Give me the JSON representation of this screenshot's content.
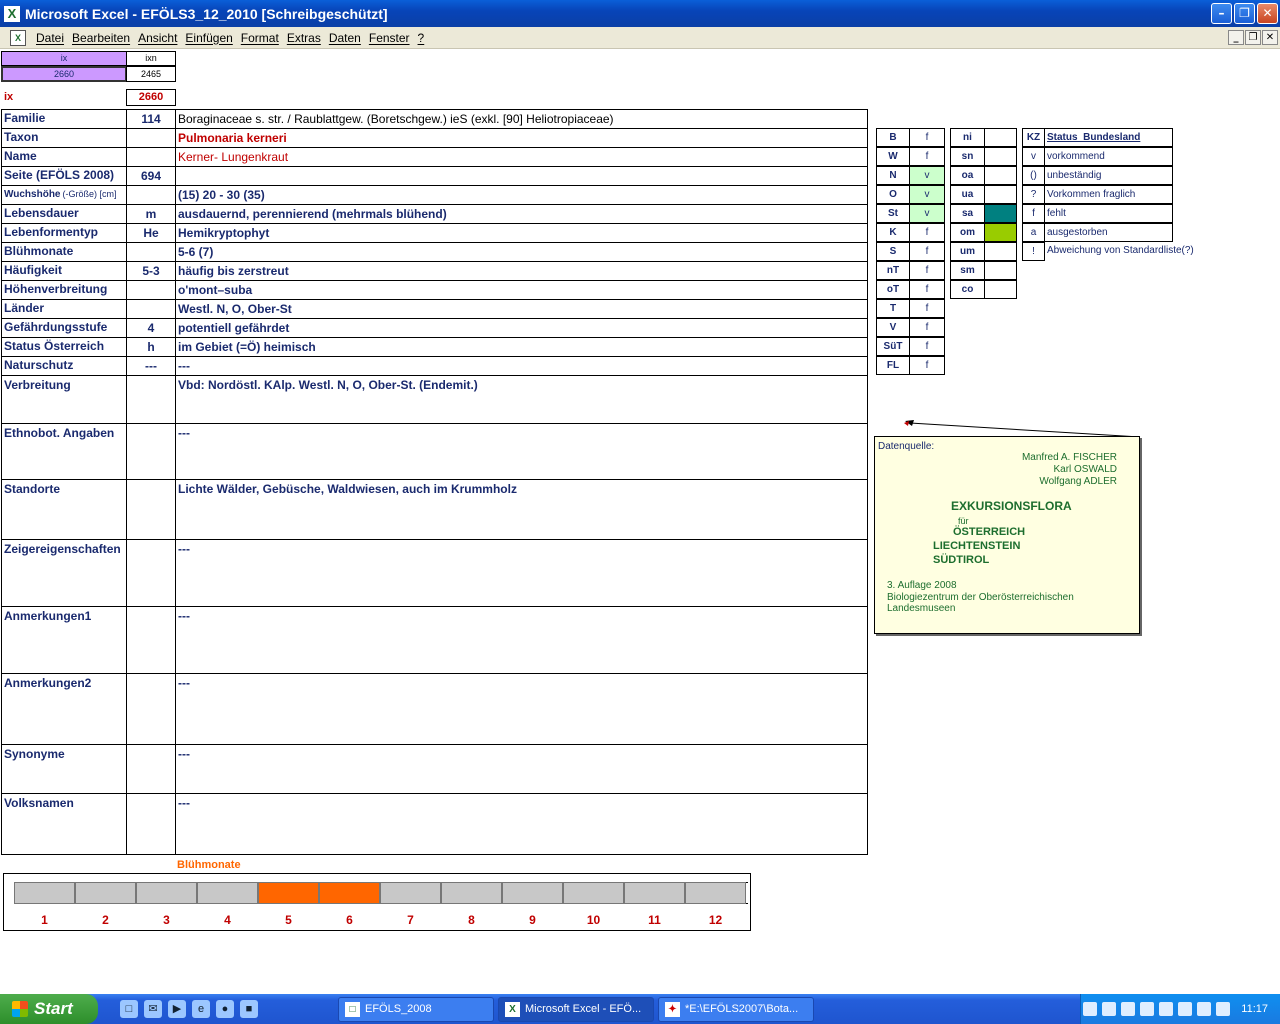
{
  "window": {
    "title": "Microsoft Excel - EFÖLS3_12_2010  [Schreibgeschützt]"
  },
  "menu": [
    "Datei",
    "Bearbeiten",
    "Ansicht",
    "Einfügen",
    "Format",
    "Extras",
    "Daten",
    "Fenster",
    "?"
  ],
  "top": {
    "ix_header": "ix",
    "ixn_header": "ixn",
    "ix_value": "2660",
    "ixn_value": "2465",
    "ix_label": "ix",
    "ix_red_value": "2660"
  },
  "rows": [
    {
      "label": "Familie",
      "code": "114",
      "value": "Boraginaceae s. str.  /  Raublattgew. (Boretschgew.) ieS (exkl. [90] Heliotropiaceae)"
    },
    {
      "label": "Taxon",
      "code": "",
      "value": "Pulmonaria kerneri"
    },
    {
      "label": "Name",
      "code": "",
      "value": "Kerner- Lungenkraut"
    },
    {
      "label": "Seite (EFÖLS 2008)",
      "code": "694",
      "value": ""
    },
    {
      "label": "Wuchshöhe",
      "label_suffix": "(-Größe) [cm]",
      "code": "",
      "value": "(15) 20 - 30 (35)"
    },
    {
      "label": "Lebensdauer",
      "code": "m",
      "value": "ausdauernd, perennierend (mehrmals blühend)"
    },
    {
      "label": "Lebenformentyp",
      "code": "He",
      "value": "Hemikryptophyt"
    },
    {
      "label": "Blühmonate",
      "code": "",
      "value": "5-6 (7)"
    },
    {
      "label": "Häufigkeit",
      "code": "5-3",
      "value": "häufig bis zerstreut"
    },
    {
      "label": "Höhenverbreitung",
      "code": "",
      "value": "o'mont–suba"
    },
    {
      "label": "Länder",
      "code": "",
      "value": "Westl. N, O, Ober-St"
    },
    {
      "label": "Gefährdungsstufe",
      "code": "4",
      "value": "potentiell gefährdet"
    },
    {
      "label": "Status Österreich",
      "code": "h",
      "value": "im Gebiet (=Ö) heimisch"
    },
    {
      "label": "Naturschutz",
      "code": "---",
      "value": "---"
    }
  ],
  "big_rows": [
    {
      "label": "Verbreitung",
      "value": "Vbd: Nordöstl. KAlp. Westl. N, O, Ober-St. (Endemit.)"
    },
    {
      "label": "Ethnobot. Angaben",
      "value": "---"
    },
    {
      "label": "Standorte",
      "value": "Lichte Wälder, Gebüsche, Waldwiesen, auch im Krummholz"
    },
    {
      "label": "Zeigereigenschaften",
      "value": "---"
    },
    {
      "label": "Anmerkungen1",
      "value": "---"
    },
    {
      "label": "Anmerkungen2",
      "value": "---"
    },
    {
      "label": "Synonyme",
      "value": "---"
    },
    {
      "label": "Volksnamen",
      "value": "---"
    }
  ],
  "states": [
    {
      "code": "B",
      "status": "f",
      "green": false
    },
    {
      "code": "W",
      "status": "f",
      "green": false
    },
    {
      "code": "N",
      "status": "v",
      "green": true
    },
    {
      "code": "O",
      "status": "v",
      "green": true
    },
    {
      "code": "St",
      "status": "v",
      "green": true
    },
    {
      "code": "K",
      "status": "f",
      "green": false
    },
    {
      "code": "S",
      "status": "f",
      "green": false
    },
    {
      "code": "nT",
      "status": "f",
      "green": false
    },
    {
      "code": "oT",
      "status": "f",
      "green": false
    },
    {
      "code": "T",
      "status": "f",
      "green": false
    },
    {
      "code": "V",
      "status": "f",
      "green": false
    },
    {
      "code": "SüT",
      "status": "f",
      "green": false
    },
    {
      "code": "FL",
      "status": "f",
      "green": false
    }
  ],
  "altitude": [
    {
      "code": "ni",
      "color": ""
    },
    {
      "code": "sn",
      "color": ""
    },
    {
      "code": "oa",
      "color": ""
    },
    {
      "code": "ua",
      "color": ""
    },
    {
      "code": "sa",
      "color": "#008080"
    },
    {
      "code": "om",
      "color": "#99cc00"
    },
    {
      "code": "um",
      "color": ""
    },
    {
      "code": "sm",
      "color": ""
    },
    {
      "code": "co",
      "color": ""
    }
  ],
  "legend": {
    "header_kz": "KZ",
    "header_status": "Status_Bundesland",
    "items": [
      {
        "kz": "v",
        "text": "vorkommend"
      },
      {
        "kz": "()",
        "text": "unbeständig"
      },
      {
        "kz": "?",
        "text": "Vorkommen fraglich"
      },
      {
        "kz": "f",
        "text": "fehlt"
      },
      {
        "kz": "a",
        "text": "ausgestorben"
      },
      {
        "kz": "!",
        "text": "Abweichung von Standardliste(?)"
      }
    ]
  },
  "note": {
    "source_label": "Datenquelle:",
    "author1": "Manfred A. FISCHER",
    "author2": "Karl OSWALD",
    "author3": "Wolfgang ADLER",
    "book1": "EXKURSIONSFLORA",
    "book2": "für",
    "book3": "ÖSTERREICH",
    "book4": "LIECHTENSTEIN",
    "book5": "SÜDTIROL",
    "edition": "3. Auflage 2008",
    "publisher": "Biologiezentrum der Oberösterreichischen Landesmuseen"
  },
  "months_chart": {
    "title": "Blühmonate",
    "months": [
      "1",
      "2",
      "3",
      "4",
      "5",
      "6",
      "7",
      "8",
      "9",
      "10",
      "11",
      "12"
    ],
    "active": [
      5,
      6
    ]
  },
  "taskbar": {
    "start": "Start",
    "items": [
      {
        "label": "EFÖLS_2008",
        "active": false
      },
      {
        "label": "Microsoft Excel - EFÖ...",
        "active": true
      },
      {
        "label": "*E:\\EFÖLS2007\\Bota...",
        "active": false
      }
    ],
    "clock": "11:17"
  }
}
